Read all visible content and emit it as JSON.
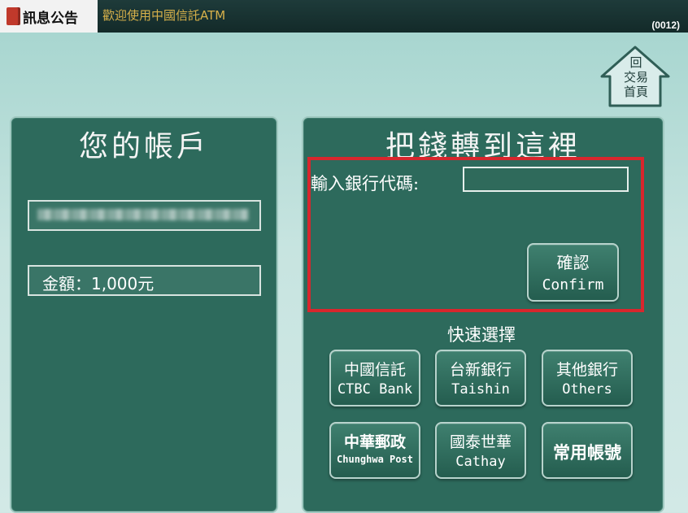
{
  "topbar": {
    "notice_label": "訊息公告",
    "marquee_text": "歡迎使用中國信託ATM",
    "screen_code": "(0012)"
  },
  "home_button": {
    "line1": "回",
    "line2": "交易",
    "line3": "首頁"
  },
  "account_panel": {
    "title": "您的帳戶",
    "account_number": "",
    "amount_text": "金額：1,000元"
  },
  "transfer_panel": {
    "title": "把錢轉到這裡",
    "bank_code_label": "輸入銀行代碼:",
    "bank_code_value": "",
    "confirm": {
      "zh": "確認",
      "en": "Confirm"
    },
    "quick_title": "快速選擇",
    "quick_buttons": [
      {
        "zh": "中國信託",
        "en": "CTBC Bank"
      },
      {
        "zh": "台新銀行",
        "en": "Taishin"
      },
      {
        "zh": "其他銀行",
        "en": "Others"
      },
      {
        "zh": "中華郵政",
        "en": "Chunghwa Post"
      },
      {
        "zh": "國泰世華",
        "en": "Cathay"
      },
      {
        "zh": "常用帳號",
        "en": ""
      }
    ]
  },
  "colors": {
    "panel": "#2d6a5c",
    "highlight": "#d8262d",
    "topbar": "#1e3b3a",
    "marquee": "#d6b04a"
  },
  "icons": [
    "notice-icon",
    "home-icon"
  ]
}
